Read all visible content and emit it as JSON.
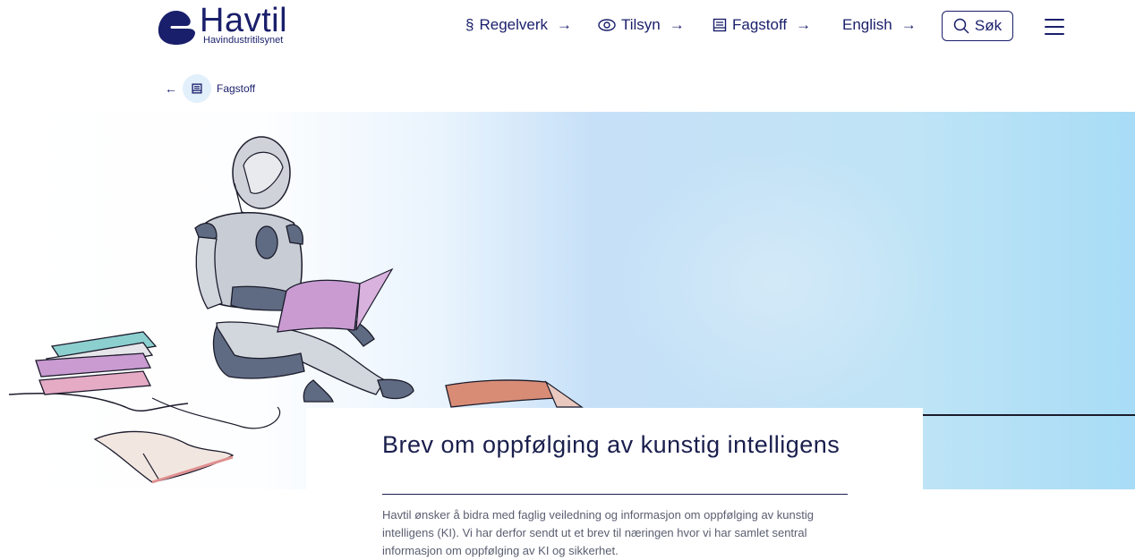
{
  "header": {
    "logo_name": "Havtil",
    "logo_subtitle": "Havindustritilsynet",
    "nav": [
      {
        "icon": "section-icon",
        "label": "Regelverk"
      },
      {
        "icon": "eye-icon",
        "label": "Tilsyn"
      },
      {
        "icon": "book-icon",
        "label": "Fagstoff"
      },
      {
        "icon": "",
        "label": "English"
      }
    ],
    "search_label": "Søk"
  },
  "breadcrumb": {
    "label": "Fagstoff"
  },
  "article": {
    "title": "Brev om oppfølging av kunstig intelligens",
    "lead": "Havtil ønsker å bidra med faglig veiledning og informasjon om oppfølging av kunstig intelligens (KI). Vi har derfor sendt ut et brev til næringen hvor vi har samlet sentral informasjon om oppfølging av KI og sikkerhet."
  },
  "colors": {
    "brand": "#1a1f6b",
    "text_muted": "#5a5e70",
    "hero_blue": "#a8dcf6"
  }
}
